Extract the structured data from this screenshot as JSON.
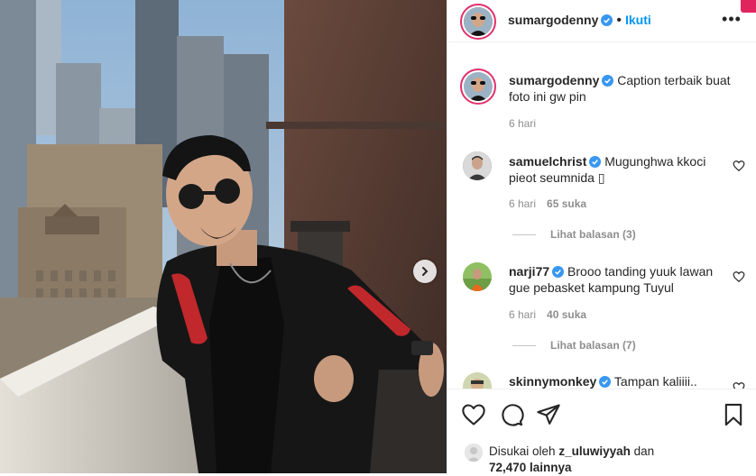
{
  "post": {
    "username": "sumargodenny",
    "follow_label": "Ikuti",
    "more_label": "•••",
    "dot": "•"
  },
  "caption": {
    "username": "sumargodenny",
    "text_line1": "Caption terbaik buat",
    "text_line2": "foto ini gw pin",
    "time": "6 hari"
  },
  "comments": [
    {
      "username": "samuelchrist",
      "text_line1": "Mugunghwa kkoci",
      "text_line2": "pieot seumnida ▯",
      "time": "6 hari",
      "likes": "65 suka",
      "replies": "Lihat balasan (3)"
    },
    {
      "username": "narji77",
      "text_line1": "Brooo tanding yuuk lawan",
      "text_line2": "gue pebasket kampung Tuyul",
      "time": "6 hari",
      "likes": "40 suka",
      "replies": "Lihat balasan (7)"
    },
    {
      "username": "skinnymonkey",
      "text_line1": "Tampan kaliiii..",
      "text_line2": ""
    }
  ],
  "liked_by": {
    "prefix": "Disukai oleh",
    "user": "z_uluwiyyah",
    "conj": "dan",
    "count": "72,470 lainnya"
  },
  "colors": {
    "accent": "#0095f6",
    "verified": "#3897f0",
    "story_ring": "#e1306c",
    "jacket_red": "#c0282c"
  },
  "icons": [
    "verified-badge-icon",
    "more-options-icon",
    "heart-icon",
    "comment-icon",
    "share-icon",
    "bookmark-icon",
    "chevron-right-icon"
  ]
}
